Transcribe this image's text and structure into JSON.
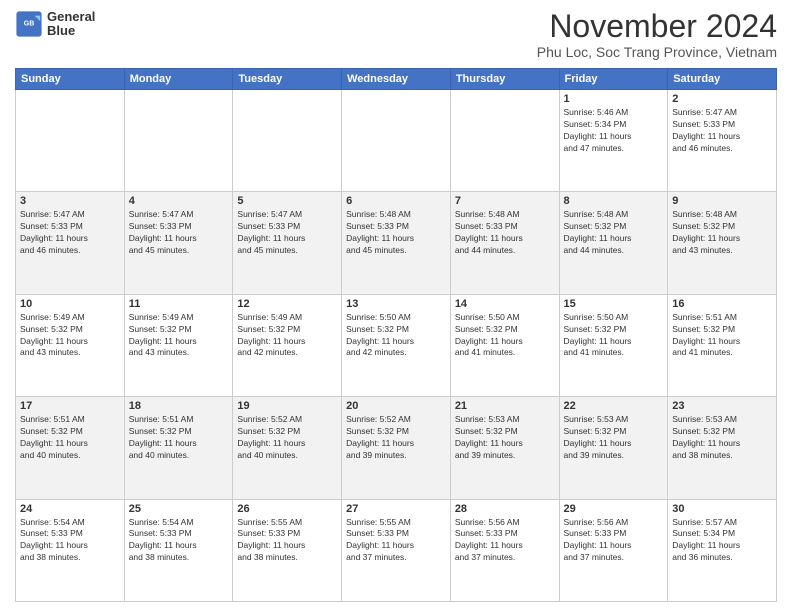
{
  "header": {
    "logo_line1": "General",
    "logo_line2": "Blue",
    "month_title": "November 2024",
    "location": "Phu Loc, Soc Trang Province, Vietnam"
  },
  "days_of_week": [
    "Sunday",
    "Monday",
    "Tuesday",
    "Wednesday",
    "Thursday",
    "Friday",
    "Saturday"
  ],
  "weeks": [
    [
      {
        "day": "",
        "info": ""
      },
      {
        "day": "",
        "info": ""
      },
      {
        "day": "",
        "info": ""
      },
      {
        "day": "",
        "info": ""
      },
      {
        "day": "",
        "info": ""
      },
      {
        "day": "1",
        "info": "Sunrise: 5:46 AM\nSunset: 5:34 PM\nDaylight: 11 hours\nand 47 minutes."
      },
      {
        "day": "2",
        "info": "Sunrise: 5:47 AM\nSunset: 5:33 PM\nDaylight: 11 hours\nand 46 minutes."
      }
    ],
    [
      {
        "day": "3",
        "info": "Sunrise: 5:47 AM\nSunset: 5:33 PM\nDaylight: 11 hours\nand 46 minutes."
      },
      {
        "day": "4",
        "info": "Sunrise: 5:47 AM\nSunset: 5:33 PM\nDaylight: 11 hours\nand 45 minutes."
      },
      {
        "day": "5",
        "info": "Sunrise: 5:47 AM\nSunset: 5:33 PM\nDaylight: 11 hours\nand 45 minutes."
      },
      {
        "day": "6",
        "info": "Sunrise: 5:48 AM\nSunset: 5:33 PM\nDaylight: 11 hours\nand 45 minutes."
      },
      {
        "day": "7",
        "info": "Sunrise: 5:48 AM\nSunset: 5:33 PM\nDaylight: 11 hours\nand 44 minutes."
      },
      {
        "day": "8",
        "info": "Sunrise: 5:48 AM\nSunset: 5:32 PM\nDaylight: 11 hours\nand 44 minutes."
      },
      {
        "day": "9",
        "info": "Sunrise: 5:48 AM\nSunset: 5:32 PM\nDaylight: 11 hours\nand 43 minutes."
      }
    ],
    [
      {
        "day": "10",
        "info": "Sunrise: 5:49 AM\nSunset: 5:32 PM\nDaylight: 11 hours\nand 43 minutes."
      },
      {
        "day": "11",
        "info": "Sunrise: 5:49 AM\nSunset: 5:32 PM\nDaylight: 11 hours\nand 43 minutes."
      },
      {
        "day": "12",
        "info": "Sunrise: 5:49 AM\nSunset: 5:32 PM\nDaylight: 11 hours\nand 42 minutes."
      },
      {
        "day": "13",
        "info": "Sunrise: 5:50 AM\nSunset: 5:32 PM\nDaylight: 11 hours\nand 42 minutes."
      },
      {
        "day": "14",
        "info": "Sunrise: 5:50 AM\nSunset: 5:32 PM\nDaylight: 11 hours\nand 41 minutes."
      },
      {
        "day": "15",
        "info": "Sunrise: 5:50 AM\nSunset: 5:32 PM\nDaylight: 11 hours\nand 41 minutes."
      },
      {
        "day": "16",
        "info": "Sunrise: 5:51 AM\nSunset: 5:32 PM\nDaylight: 11 hours\nand 41 minutes."
      }
    ],
    [
      {
        "day": "17",
        "info": "Sunrise: 5:51 AM\nSunset: 5:32 PM\nDaylight: 11 hours\nand 40 minutes."
      },
      {
        "day": "18",
        "info": "Sunrise: 5:51 AM\nSunset: 5:32 PM\nDaylight: 11 hours\nand 40 minutes."
      },
      {
        "day": "19",
        "info": "Sunrise: 5:52 AM\nSunset: 5:32 PM\nDaylight: 11 hours\nand 40 minutes."
      },
      {
        "day": "20",
        "info": "Sunrise: 5:52 AM\nSunset: 5:32 PM\nDaylight: 11 hours\nand 39 minutes."
      },
      {
        "day": "21",
        "info": "Sunrise: 5:53 AM\nSunset: 5:32 PM\nDaylight: 11 hours\nand 39 minutes."
      },
      {
        "day": "22",
        "info": "Sunrise: 5:53 AM\nSunset: 5:32 PM\nDaylight: 11 hours\nand 39 minutes."
      },
      {
        "day": "23",
        "info": "Sunrise: 5:53 AM\nSunset: 5:32 PM\nDaylight: 11 hours\nand 38 minutes."
      }
    ],
    [
      {
        "day": "24",
        "info": "Sunrise: 5:54 AM\nSunset: 5:33 PM\nDaylight: 11 hours\nand 38 minutes."
      },
      {
        "day": "25",
        "info": "Sunrise: 5:54 AM\nSunset: 5:33 PM\nDaylight: 11 hours\nand 38 minutes."
      },
      {
        "day": "26",
        "info": "Sunrise: 5:55 AM\nSunset: 5:33 PM\nDaylight: 11 hours\nand 38 minutes."
      },
      {
        "day": "27",
        "info": "Sunrise: 5:55 AM\nSunset: 5:33 PM\nDaylight: 11 hours\nand 37 minutes."
      },
      {
        "day": "28",
        "info": "Sunrise: 5:56 AM\nSunset: 5:33 PM\nDaylight: 11 hours\nand 37 minutes."
      },
      {
        "day": "29",
        "info": "Sunrise: 5:56 AM\nSunset: 5:33 PM\nDaylight: 11 hours\nand 37 minutes."
      },
      {
        "day": "30",
        "info": "Sunrise: 5:57 AM\nSunset: 5:34 PM\nDaylight: 11 hours\nand 36 minutes."
      }
    ]
  ]
}
